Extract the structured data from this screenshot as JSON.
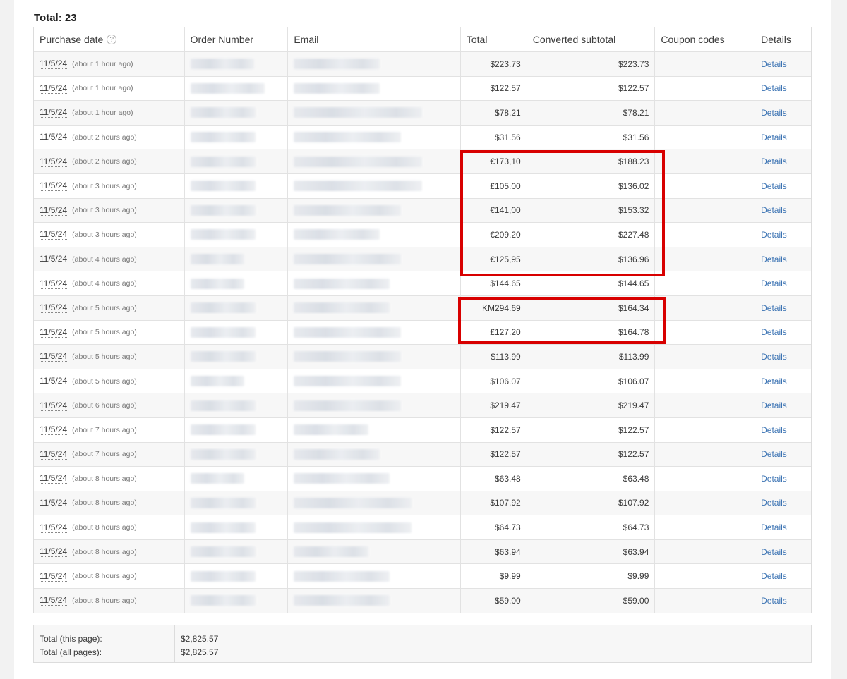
{
  "heading": {
    "total_label": "Total: 23"
  },
  "columns": {
    "purchase_date": "Purchase date",
    "order_number": "Order Number",
    "email": "Email",
    "total": "Total",
    "converted_subtotal": "Converted subtotal",
    "coupon_codes": "Coupon codes",
    "details": "Details"
  },
  "help_icon_glyph": "?",
  "rows": [
    {
      "date": "11/5/24",
      "ago": "(about 1 hour ago)",
      "total": "$223.73",
      "converted": "$223.73",
      "coupon": "",
      "details": "Details"
    },
    {
      "date": "11/5/24",
      "ago": "(about 1 hour ago)",
      "total": "$122.57",
      "converted": "$122.57",
      "coupon": "",
      "details": "Details"
    },
    {
      "date": "11/5/24",
      "ago": "(about 1 hour ago)",
      "total": "$78.21",
      "converted": "$78.21",
      "coupon": "",
      "details": "Details"
    },
    {
      "date": "11/5/24",
      "ago": "(about 2 hours ago)",
      "total": "$31.56",
      "converted": "$31.56",
      "coupon": "",
      "details": "Details"
    },
    {
      "date": "11/5/24",
      "ago": "(about 2 hours ago)",
      "total": "€173,10",
      "converted": "$188.23",
      "coupon": "",
      "details": "Details"
    },
    {
      "date": "11/5/24",
      "ago": "(about 3 hours ago)",
      "total": "£105.00",
      "converted": "$136.02",
      "coupon": "",
      "details": "Details"
    },
    {
      "date": "11/5/24",
      "ago": "(about 3 hours ago)",
      "total": "€141,00",
      "converted": "$153.32",
      "coupon": "",
      "details": "Details"
    },
    {
      "date": "11/5/24",
      "ago": "(about 3 hours ago)",
      "total": "€209,20",
      "converted": "$227.48",
      "coupon": "",
      "details": "Details"
    },
    {
      "date": "11/5/24",
      "ago": "(about 4 hours ago)",
      "total": "€125,95",
      "converted": "$136.96",
      "coupon": "",
      "details": "Details"
    },
    {
      "date": "11/5/24",
      "ago": "(about 4 hours ago)",
      "total": "$144.65",
      "converted": "$144.65",
      "coupon": "",
      "details": "Details"
    },
    {
      "date": "11/5/24",
      "ago": "(about 5 hours ago)",
      "total": "KM294.69",
      "converted": "$164.34",
      "coupon": "",
      "details": "Details"
    },
    {
      "date": "11/5/24",
      "ago": "(about 5 hours ago)",
      "total": "£127.20",
      "converted": "$164.78",
      "coupon": "",
      "details": "Details"
    },
    {
      "date": "11/5/24",
      "ago": "(about 5 hours ago)",
      "total": "$113.99",
      "converted": "$113.99",
      "coupon": "",
      "details": "Details"
    },
    {
      "date": "11/5/24",
      "ago": "(about 5 hours ago)",
      "total": "$106.07",
      "converted": "$106.07",
      "coupon": "",
      "details": "Details"
    },
    {
      "date": "11/5/24",
      "ago": "(about 6 hours ago)",
      "total": "$219.47",
      "converted": "$219.47",
      "coupon": "",
      "details": "Details"
    },
    {
      "date": "11/5/24",
      "ago": "(about 7 hours ago)",
      "total": "$122.57",
      "converted": "$122.57",
      "coupon": "",
      "details": "Details"
    },
    {
      "date": "11/5/24",
      "ago": "(about 7 hours ago)",
      "total": "$122.57",
      "converted": "$122.57",
      "coupon": "",
      "details": "Details"
    },
    {
      "date": "11/5/24",
      "ago": "(about 8 hours ago)",
      "total": "$63.48",
      "converted": "$63.48",
      "coupon": "",
      "details": "Details"
    },
    {
      "date": "11/5/24",
      "ago": "(about 8 hours ago)",
      "total": "$107.92",
      "converted": "$107.92",
      "coupon": "",
      "details": "Details"
    },
    {
      "date": "11/5/24",
      "ago": "(about 8 hours ago)",
      "total": "$64.73",
      "converted": "$64.73",
      "coupon": "",
      "details": "Details"
    },
    {
      "date": "11/5/24",
      "ago": "(about 8 hours ago)",
      "total": "$63.94",
      "converted": "$63.94",
      "coupon": "",
      "details": "Details"
    },
    {
      "date": "11/5/24",
      "ago": "(about 8 hours ago)",
      "total": "$9.99",
      "converted": "$9.99",
      "coupon": "",
      "details": "Details"
    },
    {
      "date": "11/5/24",
      "ago": "(about 8 hours ago)",
      "total": "$59.00",
      "converted": "$59.00",
      "coupon": "",
      "details": "Details"
    }
  ],
  "footer": {
    "this_page_label": "Total (this page):",
    "all_pages_label": "Total (all pages):",
    "this_page_value": "$2,825.57",
    "all_pages_value": "$2,825.57"
  },
  "colors": {
    "highlight": "#d80000",
    "link": "#3b73b3"
  }
}
